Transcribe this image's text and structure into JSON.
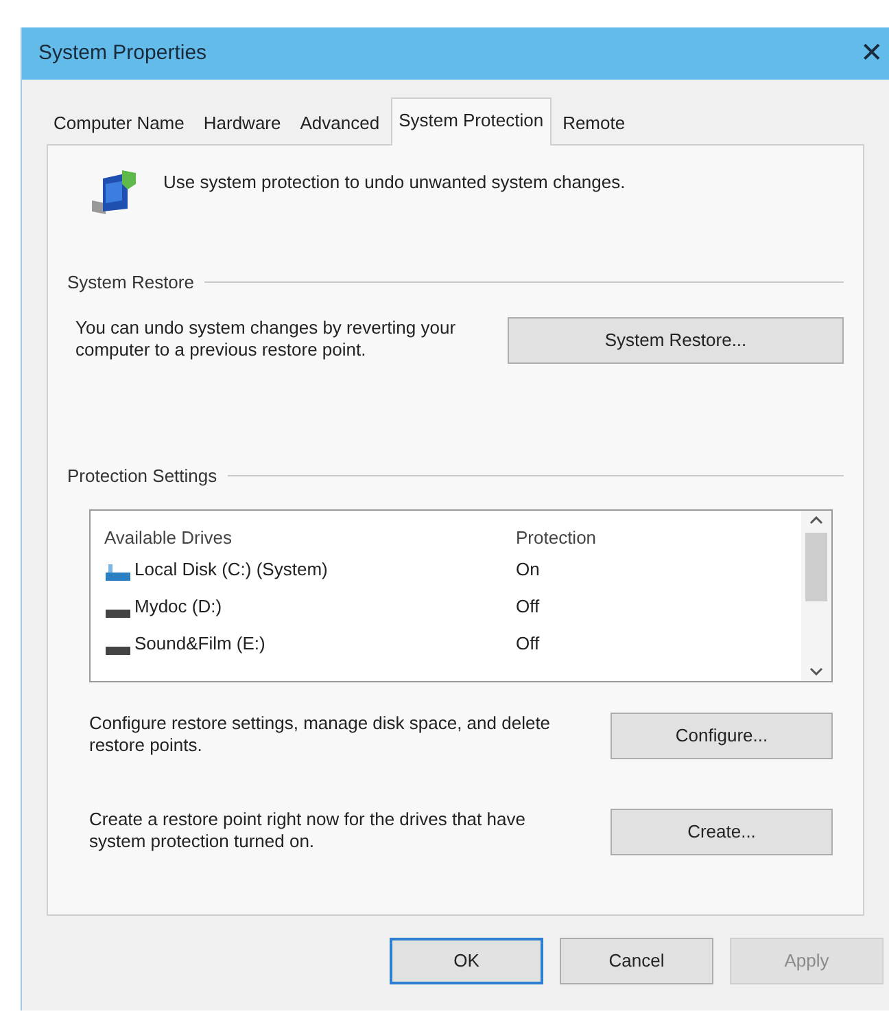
{
  "window": {
    "title": "System Properties",
    "close": "✕"
  },
  "tabs": [
    {
      "label": "Computer Name",
      "selected": false
    },
    {
      "label": "Hardware",
      "selected": false
    },
    {
      "label": "Advanced",
      "selected": false
    },
    {
      "label": "System Protection",
      "selected": true
    },
    {
      "label": "Remote",
      "selected": false
    }
  ],
  "intro": "Use system protection to undo unwanted system changes.",
  "system_restore": {
    "heading": "System Restore",
    "text": "You can undo system changes by reverting your computer to a previous restore point.",
    "button": "System Restore..."
  },
  "protection_settings": {
    "heading": "Protection Settings",
    "columns": [
      "Available Drives",
      "Protection"
    ],
    "drives": [
      {
        "name": "Local Disk (C:) (System)",
        "protection": "On",
        "kind": "system"
      },
      {
        "name": "Mydoc (D:)",
        "protection": "Off",
        "kind": "drive"
      },
      {
        "name": "Sound&Film (E:)",
        "protection": "Off",
        "kind": "drive"
      }
    ],
    "actions": [
      {
        "text": "Configure restore settings, manage disk space, and delete restore points.",
        "button": "Configure..."
      },
      {
        "text": "Create a restore point right now for the drives that have system protection turned on.",
        "button": "Create..."
      }
    ]
  },
  "buttons": [
    {
      "label": "OK",
      "default": true,
      "disabled": false
    },
    {
      "label": "Cancel",
      "default": false,
      "disabled": false
    },
    {
      "label": "Apply",
      "default": false,
      "disabled": true
    }
  ]
}
